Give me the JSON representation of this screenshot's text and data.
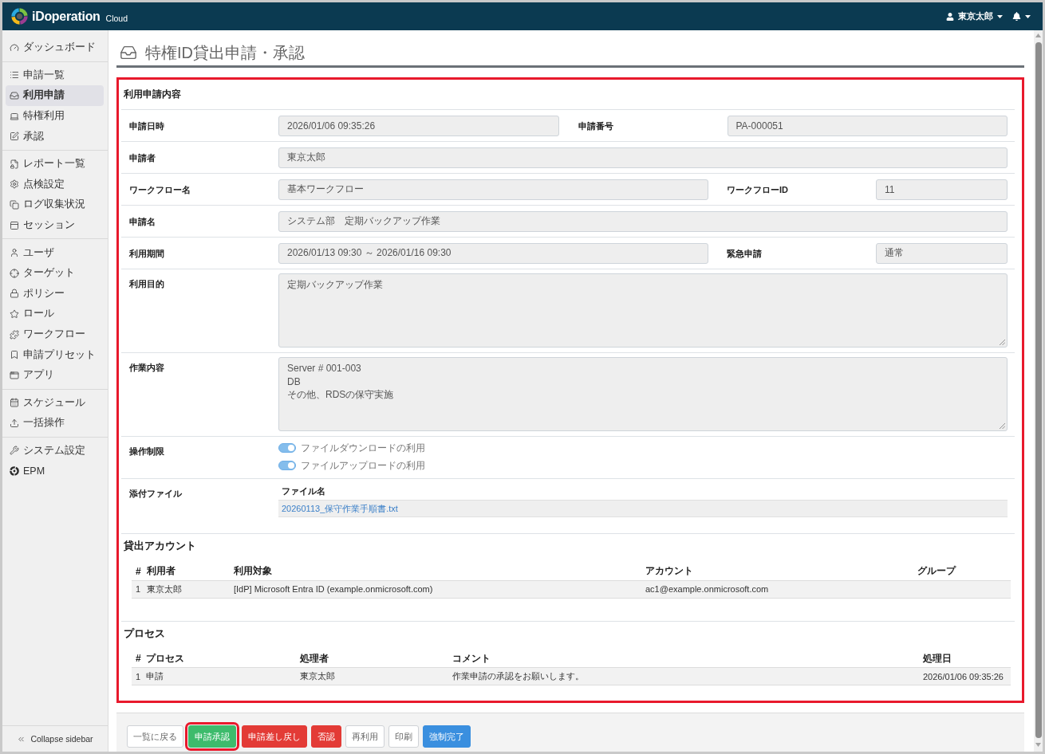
{
  "header": {
    "logo": "iDoperation",
    "logo_suffix": "Cloud",
    "user": "東京太郎"
  },
  "sidebar": {
    "groups": [
      [
        {
          "label": "ダッシュボード",
          "selected": false
        }
      ],
      [
        {
          "label": "申請一覧",
          "selected": false
        },
        {
          "label": "利用申請",
          "selected": true
        },
        {
          "label": "特権利用",
          "selected": false
        },
        {
          "label": "承認",
          "selected": false
        }
      ],
      [
        {
          "label": "レポート一覧",
          "selected": false
        },
        {
          "label": "点検設定",
          "selected": false
        },
        {
          "label": "ログ収集状況",
          "selected": false
        },
        {
          "label": "セッション",
          "selected": false
        }
      ],
      [
        {
          "label": "ユーザ",
          "selected": false
        },
        {
          "label": "ターゲット",
          "selected": false
        },
        {
          "label": "ポリシー",
          "selected": false
        },
        {
          "label": "ロール",
          "selected": false
        },
        {
          "label": "ワークフロー",
          "selected": false
        },
        {
          "label": "申請プリセット",
          "selected": false
        },
        {
          "label": "アプリ",
          "selected": false
        }
      ],
      [
        {
          "label": "スケジュール",
          "selected": false
        },
        {
          "label": "一括操作",
          "selected": false
        }
      ],
      [
        {
          "label": "システム設定",
          "selected": false
        },
        {
          "label": "EPM",
          "selected": false
        }
      ]
    ],
    "collapse": "Collapse sidebar"
  },
  "page_title": "特権ID貸出申請・承認",
  "detail": {
    "highlighted": true,
    "form": {
      "title": "利用申請内容",
      "rows": [
        {
          "kind": "pair",
          "fields": [
            {
              "label": "申請日時",
              "value": "2026/01/06 09:35:26"
            },
            {
              "label": "申請番号",
              "value": "PA-000051"
            }
          ]
        },
        {
          "kind": "single",
          "fields": [
            {
              "label": "申請者",
              "value": "東京太郎"
            }
          ]
        },
        {
          "kind": "split",
          "fields": [
            {
              "label": "ワークフロー名",
              "value": "基本ワークフロー"
            },
            {
              "label": "ワークフローID",
              "value": "11"
            }
          ]
        },
        {
          "kind": "single",
          "fields": [
            {
              "label": "申請名",
              "value": "システム部　定期バックアップ作業"
            }
          ]
        },
        {
          "kind": "split",
          "fields": [
            {
              "label": "利用期間",
              "value": "2026/01/13 09:30 ～ 2026/01/16 09:30"
            },
            {
              "label": "緊急申請",
              "value": "通常"
            }
          ]
        },
        {
          "kind": "textarea",
          "fields": [
            {
              "label": "利用目的",
              "value": "定期バックアップ作業"
            }
          ]
        },
        {
          "kind": "textarea",
          "fields": [
            {
              "label": "作業内容",
              "value": "Server # 001-003\nDB\nその他、RDSの保守実施"
            }
          ]
        },
        {
          "kind": "toggles",
          "label": "操作制限",
          "toggles": [
            {
              "label": "ファイルダウンロードの利用",
              "on": true
            },
            {
              "label": "ファイルアップロードの利用",
              "on": true
            }
          ]
        },
        {
          "kind": "files",
          "label": "添付ファイル",
          "column": "ファイル名",
          "files": [
            "20260113_保守作業手順書.txt"
          ]
        }
      ]
    },
    "accounts": {
      "title": "貸出アカウント",
      "columns": [
        "#",
        "利用者",
        "利用対象",
        "アカウント",
        "グループ"
      ],
      "rows": [
        [
          "1",
          "東京太郎",
          "[IdP] Microsoft Entra ID (example.onmicrosoft.com)",
          "ac1@example.onmicrosoft.com"
        ]
      ]
    },
    "process": {
      "title": "プロセス",
      "columns": [
        "#",
        "プロセス",
        "処理者",
        "コメント",
        "処理日"
      ],
      "rows": [
        [
          "1",
          "申請",
          "東京太郎",
          "作業申請の承認をお願いします。",
          "2026/01/06 09:35:26"
        ]
      ]
    }
  },
  "actions": [
    {
      "label": "一覧に戻る",
      "kind": "default",
      "highlighted": false
    },
    {
      "label": "申請承認",
      "kind": "success",
      "highlighted": true
    },
    {
      "label": "申請差し戻し",
      "kind": "danger",
      "highlighted": false
    },
    {
      "label": "否認",
      "kind": "danger",
      "highlighted": false
    },
    {
      "label": "再利用",
      "kind": "default",
      "highlighted": false
    },
    {
      "label": "印刷",
      "kind": "default",
      "highlighted": false
    },
    {
      "label": "強制完了",
      "kind": "primary",
      "highlighted": false
    }
  ]
}
